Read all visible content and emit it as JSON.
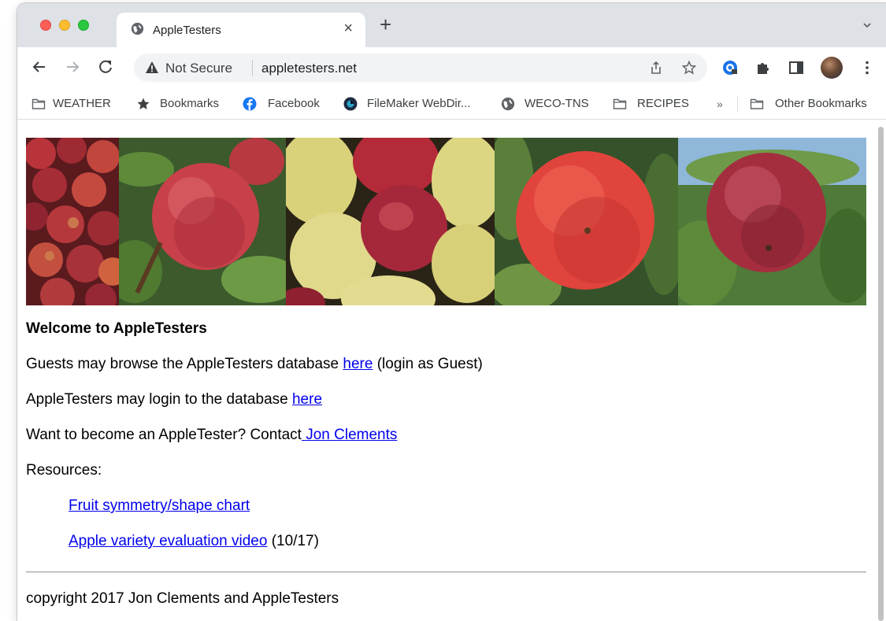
{
  "browser": {
    "tab_title": "AppleTesters",
    "url_security": "Not Secure",
    "url": "appletesters.net",
    "bookmarks": [
      {
        "label": "WEATHER",
        "icon": "folder-icon"
      },
      {
        "label": "Bookmarks",
        "icon": "star-icon"
      },
      {
        "label": "Facebook",
        "icon": "facebook-icon"
      },
      {
        "label": "FileMaker WebDir...",
        "icon": "filemaker-icon"
      },
      {
        "label": "WECO-TNS",
        "icon": "globe-icon"
      },
      {
        "label": "RECIPES",
        "icon": "folder-icon"
      }
    ],
    "more_bookmarks": "»",
    "other_bookmarks": "Other Bookmarks"
  },
  "page": {
    "welcome": "Welcome to AppleTesters",
    "guests_prefix": "Guests may browse the AppleTesters database ",
    "guests_link": "here",
    "guests_suffix": " (login as Guest)",
    "testers_prefix": "AppleTesters may login to the database ",
    "testers_link": "here",
    "become_prefix": "Want to become an AppleTester? Contact",
    "become_link": " Jon Clements",
    "resources": "Resources:",
    "resource_1": "Fruit symmetry/shape chart",
    "resource_2": "Apple variety evaluation video",
    "resource_2_suffix": " (10/17)",
    "copyright": "copyright 2017 Jon Clements and AppleTesters"
  },
  "colors": {
    "link": "#0000ee",
    "tab_strip": "#dee1e6",
    "omnibox": "#f1f3f4"
  }
}
